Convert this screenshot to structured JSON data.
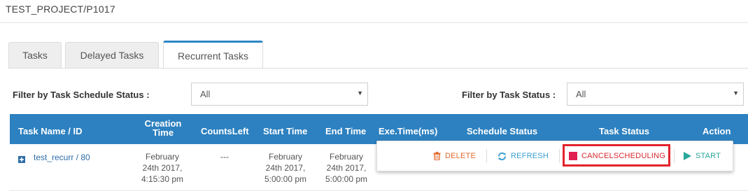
{
  "breadcrumb": {
    "project": "TEST_PROJECT/P1017"
  },
  "tabs": [
    {
      "label": "Tasks"
    },
    {
      "label": "Delayed Tasks"
    },
    {
      "label": "Recurrent Tasks"
    }
  ],
  "filters": {
    "schedule_label": "Filter by Task Schedule Status :",
    "schedule_value": "All",
    "status_label": "Filter by Task Status :",
    "status_value": "All"
  },
  "table": {
    "headers": {
      "name": "Task Name / ID",
      "creation_line1": "Creation",
      "creation_line2": "Time",
      "counts_left": "CountsLeft",
      "start_time": "Start Time",
      "end_time": "End Time",
      "exe_time": "Exe.Time(ms)",
      "schedule_status": "Schedule Status",
      "task_status": "Task Status",
      "action": "Action"
    },
    "rows": [
      {
        "name": "test_recurr / 80",
        "creation": [
          "February",
          "24th 2017,",
          "4:15:30 pm"
        ],
        "counts_left": "---",
        "start": [
          "February",
          "24th 2017,",
          "5:00:00 pm"
        ],
        "end": [
          "February",
          "24th 2017,",
          "5:00:00 pm"
        ]
      }
    ]
  },
  "actions": {
    "delete": "DELETE",
    "refresh": "REFRESH",
    "cancel": "CANCELSCHEDULING",
    "start": "START"
  },
  "colors": {
    "header_blue": "#2d81c0",
    "tab_accent": "#2d86c6",
    "delete": "#e06a2e",
    "refresh": "#3b9fcf",
    "cancel": "#d9282f",
    "start": "#2aa89a",
    "highlight": "#e3232c"
  }
}
